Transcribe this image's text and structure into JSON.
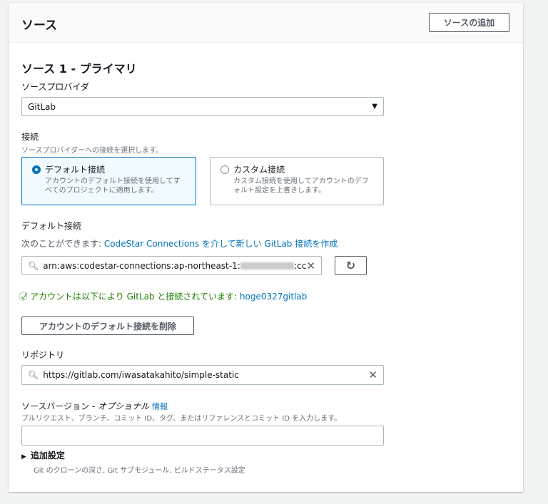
{
  "header": {
    "title": "ソース",
    "add_source_button": "ソースの追加"
  },
  "source": {
    "title": "ソース 1 - プライマリ",
    "provider_label": "ソースプロバイダ",
    "provider_value": "GitLab",
    "connection_label": "接続",
    "connection_desc": "ソースプロバイダーへの接続を選択します。",
    "tiles": [
      {
        "title": "デフォルト接続",
        "desc": "アカウントのデフォルト接続を使用してすべてのプロジェクトに適用します。",
        "selected": true
      },
      {
        "title": "カスタム接続",
        "desc": "カスタム接続を使用してアカウントのデフォルト設定を上書きします。",
        "selected": false
      }
    ],
    "default_conn_label": "デフォルト接続",
    "create_prefix": "次のことができます: ",
    "create_link": "CodeStar Connections を介して新しい GitLab 接続を作成",
    "arn_value": "arn:aws:codestar-connections:ap-northeast-1:",
    "arn_suffix": ":cc",
    "success_text": "アカウントは以下により GitLab と接続されています: ",
    "success_link": "hoge0327gitlab",
    "delete_button": "アカウントのデフォルト接続を削除",
    "repo_label": "リポジトリ",
    "repo_value": "https://gitlab.com/iwasatakahito/simple-static",
    "version_label": "ソースバージョン - ",
    "version_optional": "オプショナル",
    "version_info": "情報",
    "version_desc": "プルリクエスト、ブランチ、コミット ID、タグ、またはリファレンスとコミット ID を入力します。",
    "version_value": "",
    "additional_title": "追加設定",
    "additional_desc": "Git のクローンの深さ, Git サブモジュール, ビルドステータス設定"
  },
  "colors": {
    "accent": "#0073bb",
    "success": "#1d8102"
  }
}
